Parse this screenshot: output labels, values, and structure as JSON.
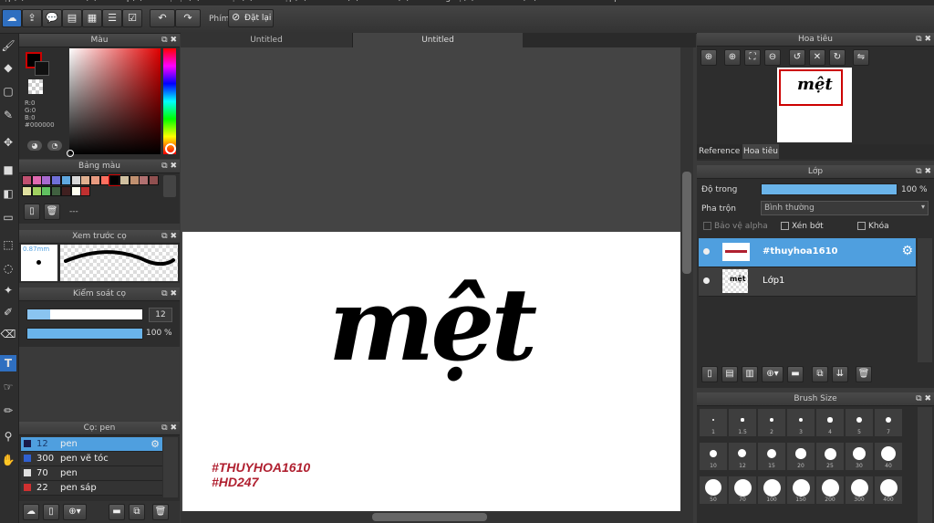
{
  "menubar": {
    "items": [
      "Tệp(F)",
      "Chỉnh sửa(E)",
      "Lớp(L)",
      "Bộ lọc(R)",
      "Chọn(S)",
      "Chụp(N)",
      "Màu (C)",
      "Xem(V)",
      "Công cụ(T)",
      "Cửa sổ(W)",
      "Cloud",
      "Help"
    ]
  },
  "toolbar": {
    "phim_label": "Phím",
    "reset_label": "Đặt lại"
  },
  "tabs": {
    "tab1": "Untitled",
    "tab2": "Untitled"
  },
  "color_panel": {
    "title": "Màu",
    "r_label": "R:0",
    "g_label": "G:0",
    "b_label": "B:0",
    "hex_label": "#000000"
  },
  "palette_panel": {
    "title": "Bảng màu",
    "dash_text": "---",
    "swatches": [
      "#c05070",
      "#e06ab0",
      "#a86ad0",
      "#7070d8",
      "#60a8e0",
      "#d8d8d8",
      "#e0b090",
      "#e89a80",
      "#ff7060",
      "#000000",
      "#d0c0a0",
      "#c09070",
      "#b07070",
      "#905050",
      "#e0e0a0",
      "#a0d060",
      "#60c060",
      "#406040",
      "#402020",
      "#fffff0",
      "#c03030"
    ]
  },
  "brush_preview": {
    "title": "Xem trước cọ",
    "size": "0.87mm"
  },
  "brush_control": {
    "title": "Kiểm soát cọ",
    "size_value": "12",
    "opacity_value": "100 %",
    "size_fraction": 0.2,
    "opacity_fraction": 1.0
  },
  "brush_panel": {
    "title": "Cọ: pen",
    "rows": [
      {
        "num": "12",
        "name": "pen",
        "color": "#1a1a4a"
      },
      {
        "num": "300",
        "name": "pen vẽ tóc",
        "color": "#3060d0"
      },
      {
        "num": "70",
        "name": "pen",
        "color": "#e0e0e0"
      },
      {
        "num": "22",
        "name": "pen sáp",
        "color": "#d03030"
      }
    ]
  },
  "canvas": {
    "text": "mệt",
    "signature_line1": "#THUYHOA1610",
    "signature_line2": "#HD247"
  },
  "navigator": {
    "title": "Hoa tiêu",
    "tab_reference": "Reference",
    "tab_navigator": "Hoa tiêu"
  },
  "layers_panel": {
    "title": "Lớp",
    "opacity_label": "Độ trong",
    "opacity_value": "100 %",
    "opacity_fraction": 1.0,
    "blend_label": "Pha trộn",
    "blend_value": "Bình thường",
    "protect_alpha": "Bảo vệ alpha",
    "clipping": "Xén bớt",
    "lock": "Khóa",
    "layers": [
      {
        "name": "#thuyhoa1610"
      },
      {
        "name": "Lớp1"
      }
    ]
  },
  "brush_size_panel": {
    "title": "Brush Size",
    "sizes": [
      "1",
      "1.5",
      "2",
      "3",
      "4",
      "5",
      "7",
      "10",
      "12",
      "15",
      "20",
      "25",
      "30",
      "40",
      "50",
      "70",
      "100",
      "150",
      "200",
      "300",
      "400"
    ]
  }
}
